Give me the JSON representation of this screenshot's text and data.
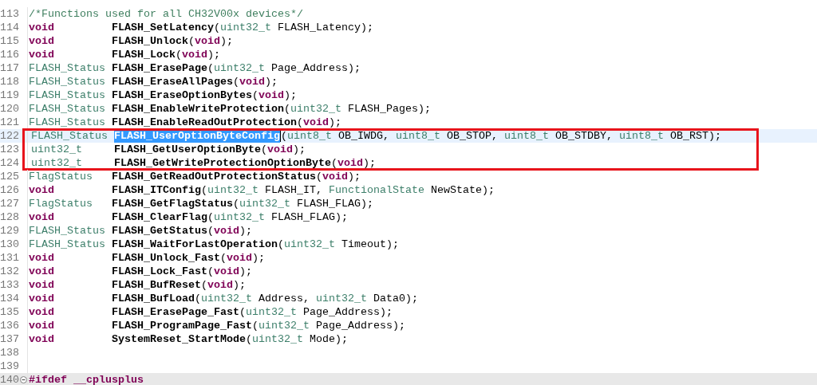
{
  "editor": {
    "lines": [
      {
        "number": "113",
        "kind": "comment",
        "text": "/*Functions used for all CH32V00x devices*/"
      },
      {
        "number": "114",
        "kind": "decl",
        "return_type": {
          "text": "void",
          "kind": "keyword"
        },
        "name": "FLASH_SetLatency",
        "args": [
          {
            "text": "(",
            "kind": "plain"
          },
          {
            "text": "uint32_t",
            "kind": "type"
          },
          {
            "text": " FLASH_Latency);",
            "kind": "plain"
          }
        ]
      },
      {
        "number": "115",
        "kind": "decl",
        "return_type": {
          "text": "void",
          "kind": "keyword"
        },
        "name": "FLASH_Unlock",
        "args": [
          {
            "text": "(",
            "kind": "plain"
          },
          {
            "text": "void",
            "kind": "keyword"
          },
          {
            "text": ");",
            "kind": "plain"
          }
        ]
      },
      {
        "number": "116",
        "kind": "decl",
        "return_type": {
          "text": "void",
          "kind": "keyword"
        },
        "name": "FLASH_Lock",
        "args": [
          {
            "text": "(",
            "kind": "plain"
          },
          {
            "text": "void",
            "kind": "keyword"
          },
          {
            "text": ");",
            "kind": "plain"
          }
        ]
      },
      {
        "number": "117",
        "kind": "decl",
        "return_type": {
          "text": "FLASH_Status",
          "kind": "type"
        },
        "name": "FLASH_ErasePage",
        "args": [
          {
            "text": "(",
            "kind": "plain"
          },
          {
            "text": "uint32_t",
            "kind": "type"
          },
          {
            "text": " Page_Address);",
            "kind": "plain"
          }
        ]
      },
      {
        "number": "118",
        "kind": "decl",
        "return_type": {
          "text": "FLASH_Status",
          "kind": "type"
        },
        "name": "FLASH_EraseAllPages",
        "args": [
          {
            "text": "(",
            "kind": "plain"
          },
          {
            "text": "void",
            "kind": "keyword"
          },
          {
            "text": ");",
            "kind": "plain"
          }
        ]
      },
      {
        "number": "119",
        "kind": "decl",
        "return_type": {
          "text": "FLASH_Status",
          "kind": "type"
        },
        "name": "FLASH_EraseOptionBytes",
        "args": [
          {
            "text": "(",
            "kind": "plain"
          },
          {
            "text": "void",
            "kind": "keyword"
          },
          {
            "text": ");",
            "kind": "plain"
          }
        ]
      },
      {
        "number": "120",
        "kind": "decl",
        "return_type": {
          "text": "FLASH_Status",
          "kind": "type"
        },
        "name": "FLASH_EnableWriteProtection",
        "args": [
          {
            "text": "(",
            "kind": "plain"
          },
          {
            "text": "uint32_t",
            "kind": "type"
          },
          {
            "text": " FLASH_Pages);",
            "kind": "plain"
          }
        ]
      },
      {
        "number": "121",
        "kind": "decl",
        "return_type": {
          "text": "FLASH_Status",
          "kind": "type"
        },
        "name": "FLASH_EnableReadOutProtection",
        "args": [
          {
            "text": "(",
            "kind": "plain"
          },
          {
            "text": "void",
            "kind": "keyword"
          },
          {
            "text": ");",
            "kind": "plain"
          }
        ]
      },
      {
        "number": "122",
        "kind": "decl",
        "current": true,
        "boxed": true,
        "return_type": {
          "text": "FLASH_Status",
          "kind": "type"
        },
        "name": "FLASH_UserOptionByteConfig",
        "name_selected": true,
        "args": [
          {
            "text": "(",
            "kind": "plain"
          },
          {
            "text": "uint8_t",
            "kind": "type"
          },
          {
            "text": " OB_IWDG, ",
            "kind": "plain"
          },
          {
            "text": "uint8_t",
            "kind": "type"
          },
          {
            "text": " OB_STOP, ",
            "kind": "plain"
          },
          {
            "text": "uint8_t",
            "kind": "type"
          },
          {
            "text": " OB_STDBY, ",
            "kind": "plain"
          },
          {
            "text": "uint8_t",
            "kind": "type"
          },
          {
            "text": " OB_RST);",
            "kind": "plain"
          }
        ]
      },
      {
        "number": "123",
        "kind": "decl",
        "boxed": true,
        "return_type": {
          "text": "uint32_t",
          "kind": "type"
        },
        "name": "FLASH_GetUserOptionByte",
        "args": [
          {
            "text": "(",
            "kind": "plain"
          },
          {
            "text": "void",
            "kind": "keyword"
          },
          {
            "text": ");",
            "kind": "plain"
          }
        ]
      },
      {
        "number": "124",
        "kind": "decl",
        "boxed": true,
        "return_type": {
          "text": "uint32_t",
          "kind": "type"
        },
        "name": "FLASH_GetWriteProtectionOptionByte",
        "args": [
          {
            "text": "(",
            "kind": "plain"
          },
          {
            "text": "void",
            "kind": "keyword"
          },
          {
            "text": ");",
            "kind": "plain"
          }
        ]
      },
      {
        "number": "125",
        "kind": "decl",
        "return_type": {
          "text": "FlagStatus",
          "kind": "type"
        },
        "name": "FLASH_GetReadOutProtectionStatus",
        "args": [
          {
            "text": "(",
            "kind": "plain"
          },
          {
            "text": "void",
            "kind": "keyword"
          },
          {
            "text": ");",
            "kind": "plain"
          }
        ]
      },
      {
        "number": "126",
        "kind": "decl",
        "return_type": {
          "text": "void",
          "kind": "keyword"
        },
        "name": "FLASH_ITConfig",
        "args": [
          {
            "text": "(",
            "kind": "plain"
          },
          {
            "text": "uint32_t",
            "kind": "type"
          },
          {
            "text": " FLASH_IT, ",
            "kind": "plain"
          },
          {
            "text": "FunctionalState",
            "kind": "type"
          },
          {
            "text": " NewState);",
            "kind": "plain"
          }
        ]
      },
      {
        "number": "127",
        "kind": "decl",
        "return_type": {
          "text": "FlagStatus",
          "kind": "type"
        },
        "name": "FLASH_GetFlagStatus",
        "args": [
          {
            "text": "(",
            "kind": "plain"
          },
          {
            "text": "uint32_t",
            "kind": "type"
          },
          {
            "text": " FLASH_FLAG);",
            "kind": "plain"
          }
        ]
      },
      {
        "number": "128",
        "kind": "decl",
        "return_type": {
          "text": "void",
          "kind": "keyword"
        },
        "name": "FLASH_ClearFlag",
        "args": [
          {
            "text": "(",
            "kind": "plain"
          },
          {
            "text": "uint32_t",
            "kind": "type"
          },
          {
            "text": " FLASH_FLAG);",
            "kind": "plain"
          }
        ]
      },
      {
        "number": "129",
        "kind": "decl",
        "return_type": {
          "text": "FLASH_Status",
          "kind": "type"
        },
        "name": "FLASH_GetStatus",
        "args": [
          {
            "text": "(",
            "kind": "plain"
          },
          {
            "text": "void",
            "kind": "keyword"
          },
          {
            "text": ");",
            "kind": "plain"
          }
        ]
      },
      {
        "number": "130",
        "kind": "decl",
        "return_type": {
          "text": "FLASH_Status",
          "kind": "type"
        },
        "name": "FLASH_WaitForLastOperation",
        "args": [
          {
            "text": "(",
            "kind": "plain"
          },
          {
            "text": "uint32_t",
            "kind": "type"
          },
          {
            "text": " Timeout);",
            "kind": "plain"
          }
        ]
      },
      {
        "number": "131",
        "kind": "decl",
        "return_type": {
          "text": "void",
          "kind": "keyword"
        },
        "name": "FLASH_Unlock_Fast",
        "args": [
          {
            "text": "(",
            "kind": "plain"
          },
          {
            "text": "void",
            "kind": "keyword"
          },
          {
            "text": ");",
            "kind": "plain"
          }
        ]
      },
      {
        "number": "132",
        "kind": "decl",
        "return_type": {
          "text": "void",
          "kind": "keyword"
        },
        "name": "FLASH_Lock_Fast",
        "args": [
          {
            "text": "(",
            "kind": "plain"
          },
          {
            "text": "void",
            "kind": "keyword"
          },
          {
            "text": ");",
            "kind": "plain"
          }
        ]
      },
      {
        "number": "133",
        "kind": "decl",
        "return_type": {
          "text": "void",
          "kind": "keyword"
        },
        "name": "FLASH_BufReset",
        "args": [
          {
            "text": "(",
            "kind": "plain"
          },
          {
            "text": "void",
            "kind": "keyword"
          },
          {
            "text": ");",
            "kind": "plain"
          }
        ]
      },
      {
        "number": "134",
        "kind": "decl",
        "return_type": {
          "text": "void",
          "kind": "keyword"
        },
        "name": "FLASH_BufLoad",
        "args": [
          {
            "text": "(",
            "kind": "plain"
          },
          {
            "text": "uint32_t",
            "kind": "type"
          },
          {
            "text": " Address, ",
            "kind": "plain"
          },
          {
            "text": "uint32_t",
            "kind": "type"
          },
          {
            "text": " Data0);",
            "kind": "plain"
          }
        ]
      },
      {
        "number": "135",
        "kind": "decl",
        "return_type": {
          "text": "void",
          "kind": "keyword"
        },
        "name": "FLASH_ErasePage_Fast",
        "args": [
          {
            "text": "(",
            "kind": "plain"
          },
          {
            "text": "uint32_t",
            "kind": "type"
          },
          {
            "text": " Page_Address);",
            "kind": "plain"
          }
        ]
      },
      {
        "number": "136",
        "kind": "decl",
        "return_type": {
          "text": "void",
          "kind": "keyword"
        },
        "name": "FLASH_ProgramPage_Fast",
        "args": [
          {
            "text": "(",
            "kind": "plain"
          },
          {
            "text": "uint32_t",
            "kind": "type"
          },
          {
            "text": " Page_Address);",
            "kind": "plain"
          }
        ]
      },
      {
        "number": "137",
        "kind": "decl",
        "return_type": {
          "text": "void",
          "kind": "keyword"
        },
        "name": "SystemReset_StartMode",
        "args": [
          {
            "text": "(",
            "kind": "plain"
          },
          {
            "text": "uint32_t",
            "kind": "type"
          },
          {
            "text": " Mode);",
            "kind": "plain"
          }
        ]
      },
      {
        "number": "138",
        "kind": "blank"
      },
      {
        "number": "139",
        "kind": "blank"
      },
      {
        "number": "140",
        "kind": "directive",
        "collapsible": true,
        "text": "#ifdef __cplusplus"
      }
    ]
  }
}
